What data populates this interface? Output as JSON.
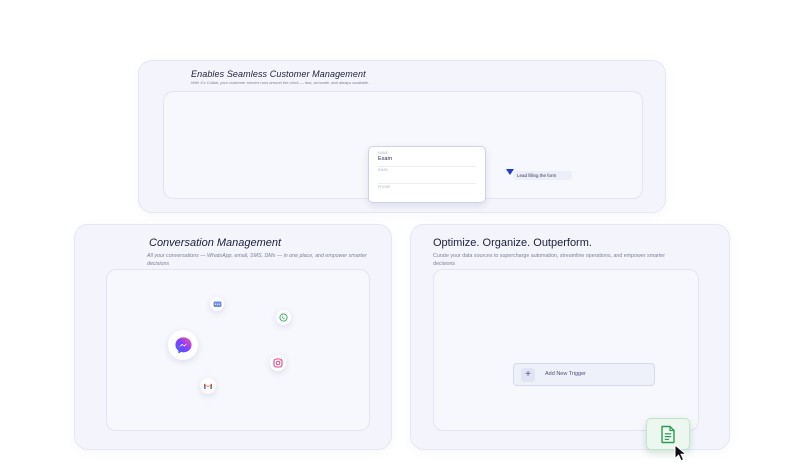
{
  "top_panel": {
    "title": "Enables Seamless Customer Management",
    "description": "With X's Collab, your customer service runs around the clock — fast, accurate, and always available.",
    "form": {
      "fields": [
        {
          "label": "NAME",
          "value": "Exam"
        },
        {
          "label": "EMAIL",
          "value": ""
        },
        {
          "label": "PHONE",
          "value": ""
        }
      ]
    },
    "tooltip": "Lead filling the form"
  },
  "conversation_panel": {
    "title": "Conversation Management",
    "description": "All your conversations — WhatsApp, email, SMS, DMs — in one place, and empower smarter decisions",
    "channels": [
      "sms-icon",
      "whatsapp-icon",
      "messenger-icon",
      "instagram-icon",
      "gmail-icon"
    ]
  },
  "optimize_panel": {
    "title": "Optimize. Organize. Outperform.",
    "description": "Curate your data sources to supercharge automation, streamline operations, and empower smarter decisions",
    "trigger_button": {
      "icon": "+",
      "label": "Add New Trigger"
    }
  },
  "colors": {
    "panel_bg": "#f4f5fc",
    "accent_blue": "#1f3bd6",
    "doc_green": "#2f9a55"
  }
}
